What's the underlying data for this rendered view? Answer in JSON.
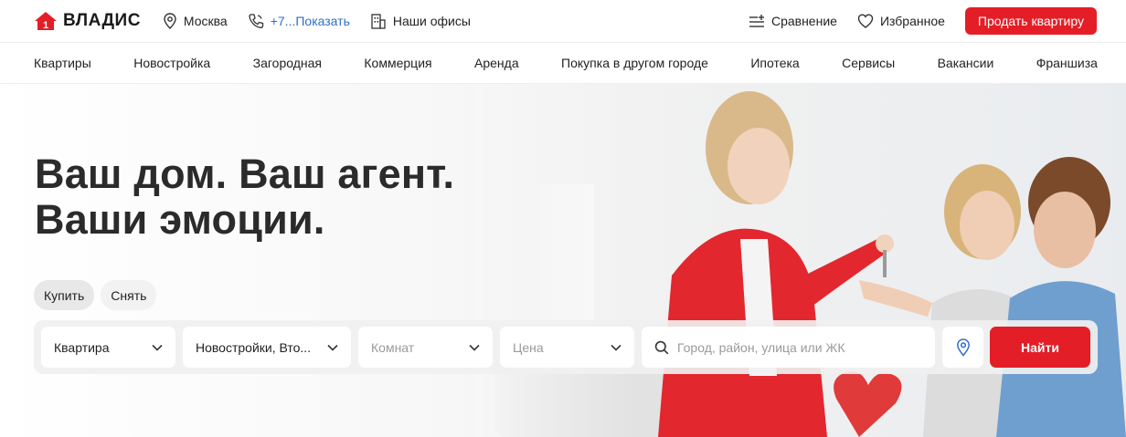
{
  "header": {
    "logo_text": "ВЛАДИС",
    "city": "Москва",
    "phone": "+7...Показать",
    "offices": "Наши офисы",
    "compare": "Сравнение",
    "favorites": "Избранное",
    "sell_button": "Продать квартиру"
  },
  "nav": {
    "items": [
      "Квартиры",
      "Новостройка",
      "Загородная",
      "Коммерция",
      "Аренда",
      "Покупка в другом городе",
      "Ипотека",
      "Сервисы",
      "Вакансии",
      "Франшиза"
    ]
  },
  "hero": {
    "headline_line1": "Ваш дом. Ваш агент.",
    "headline_line2": "Ваши эмоции."
  },
  "search": {
    "tabs": [
      "Купить",
      "Снять"
    ],
    "active_tab": "Купить",
    "property_type": "Квартира",
    "market": "Новостройки, Вто...",
    "rooms_placeholder": "Комнат",
    "price_placeholder": "Цена",
    "query_placeholder": "Город, район, улица или ЖК",
    "find_button": "Найти"
  },
  "colors": {
    "accent": "#e41e26",
    "link": "#2f6fcb"
  }
}
